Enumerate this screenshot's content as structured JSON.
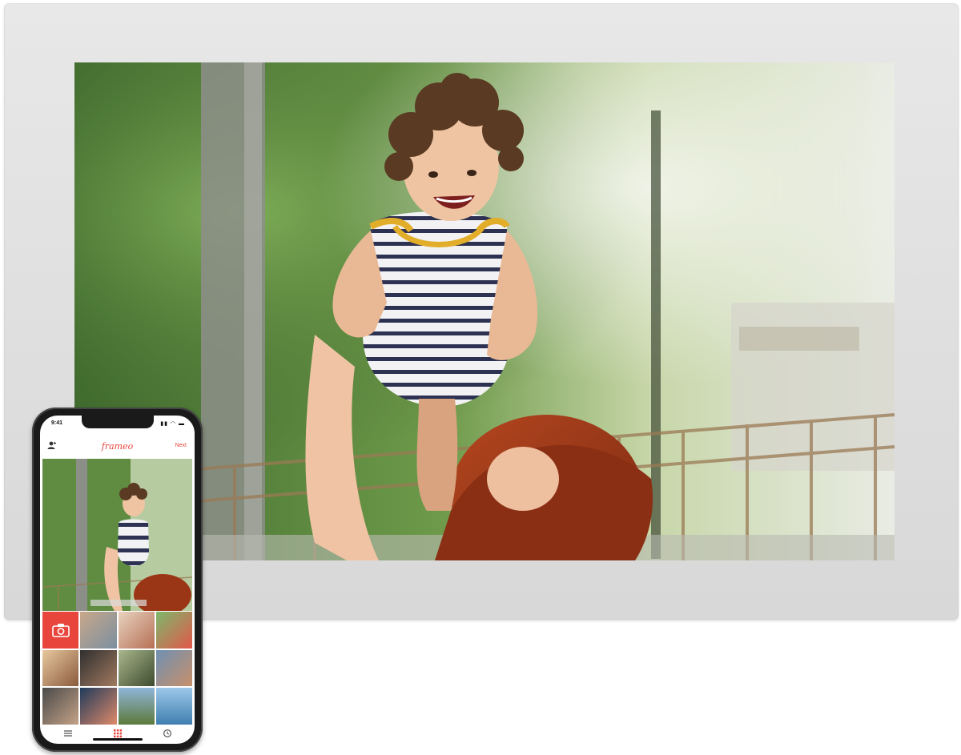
{
  "phone": {
    "status_time": "9:41",
    "status_icons": "▮▮ ◠ ▬",
    "brand": "frameo",
    "header_action": "Next"
  },
  "icons": {
    "user": "user-add-icon",
    "camera": "camera-icon",
    "menu": "menu-icon",
    "gallery": "grid-icon",
    "history": "clock-icon"
  },
  "colors": {
    "accent": "#e8453c",
    "frame": "#e0e0e0"
  }
}
